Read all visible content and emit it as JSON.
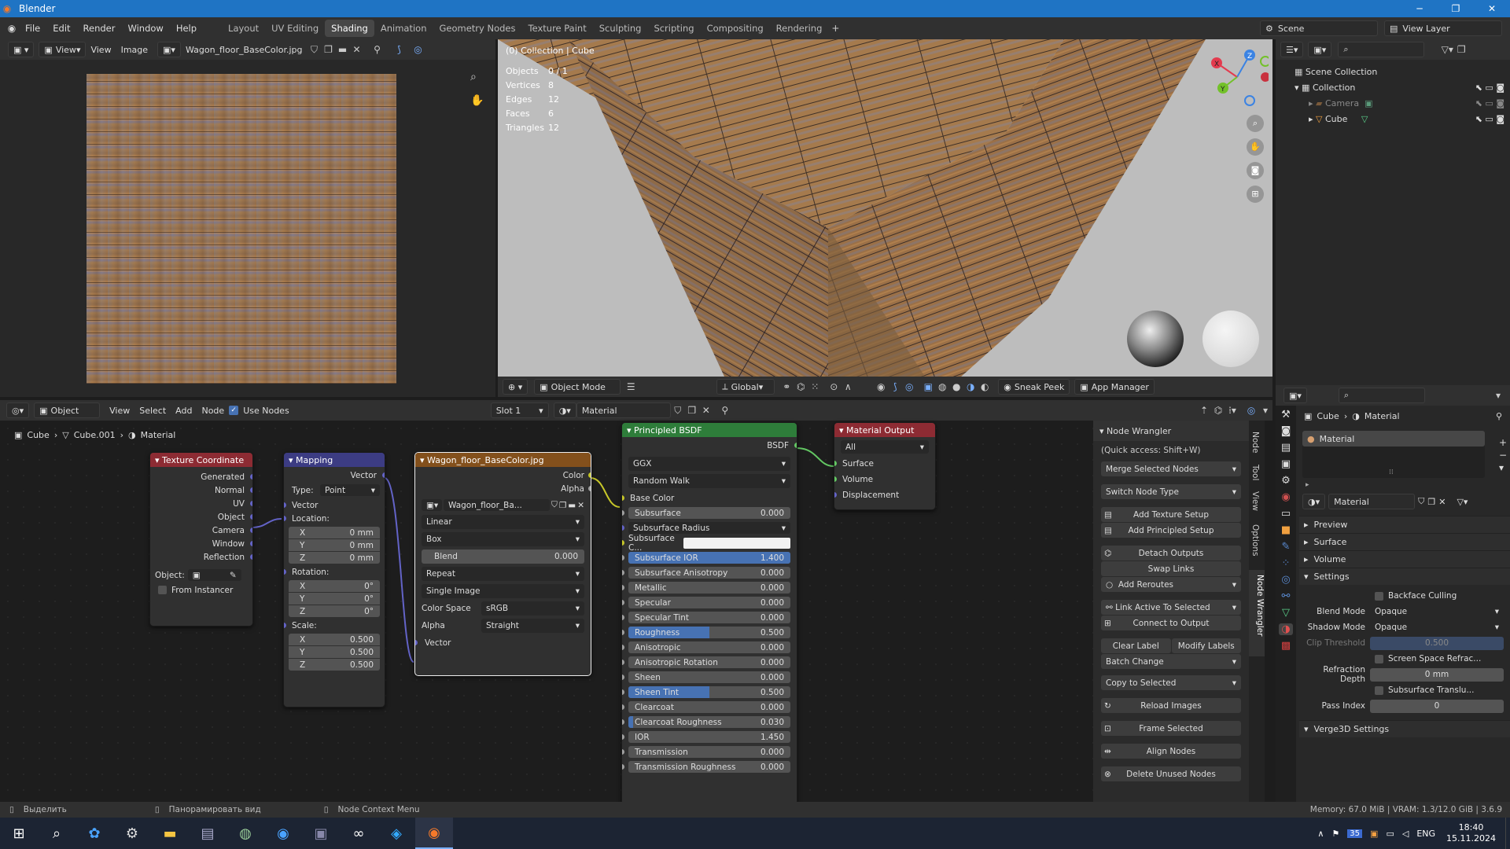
{
  "window": {
    "title": "Blender"
  },
  "menu": [
    "File",
    "Edit",
    "Render",
    "Window",
    "Help"
  ],
  "workspaces": [
    "Layout",
    "UV Editing",
    "Shading",
    "Animation",
    "Geometry Nodes",
    "Texture Paint",
    "Sculpting",
    "Scripting",
    "Compositing",
    "Rendering"
  ],
  "active_workspace": "Shading",
  "scene": "Scene",
  "view_layer": "View Layer",
  "image_editor": {
    "menus": [
      "View",
      "View",
      "Image"
    ],
    "image_name": "Wagon_floor_BaseColor.jpg"
  },
  "viewport": {
    "breadcrumb": "(0) Collection | Cube",
    "stats": [
      {
        "k": "Objects",
        "v": "0 / 1"
      },
      {
        "k": "Vertices",
        "v": "8"
      },
      {
        "k": "Edges",
        "v": "12"
      },
      {
        "k": "Faces",
        "v": "6"
      },
      {
        "k": "Triangles",
        "v": "12"
      }
    ],
    "mode": "Object Mode",
    "orientation": "Global",
    "sneak_peek": "Sneak Peek",
    "app_manager": "App Manager"
  },
  "outliner": {
    "items": [
      {
        "label": "Scene Collection"
      },
      {
        "label": "Collection"
      },
      {
        "label": "Camera"
      },
      {
        "label": "Cube"
      }
    ]
  },
  "node_editor": {
    "header": {
      "mode": "Object",
      "menus": [
        "View",
        "Select",
        "Add",
        "Node"
      ],
      "use_nodes": "Use Nodes",
      "slot": "Slot 1",
      "material": "Material"
    },
    "breadcrumb": [
      "Cube",
      "Cube.001",
      "Material"
    ]
  },
  "nodes": {
    "texcoord": {
      "title": "Texture Coordinate",
      "outputs": [
        "Generated",
        "Normal",
        "UV",
        "Object",
        "Camera",
        "Window",
        "Reflection"
      ],
      "object_label": "Object:",
      "from_instancer": "From Instancer"
    },
    "mapping": {
      "title": "Mapping",
      "output": "Vector",
      "type_label": "Type:",
      "type": "Point",
      "vector": "Vector",
      "location": "Location:",
      "rotation": "Rotation:",
      "scale": "Scale:",
      "loc": [
        {
          "a": "X",
          "v": "0 mm"
        },
        {
          "a": "Y",
          "v": "0 mm"
        },
        {
          "a": "Z",
          "v": "0 mm"
        }
      ],
      "rot": [
        {
          "a": "X",
          "v": "0°"
        },
        {
          "a": "Y",
          "v": "0°"
        },
        {
          "a": "Z",
          "v": "0°"
        }
      ],
      "scl": [
        {
          "a": "X",
          "v": "0.500"
        },
        {
          "a": "Y",
          "v": "0.500"
        },
        {
          "a": "Z",
          "v": "0.500"
        }
      ]
    },
    "image": {
      "title": "Wagon_floor_BaseColor.jpg",
      "outputs": [
        "Color",
        "Alpha"
      ],
      "img": "Wagon_floor_Ba...",
      "interp": "Linear",
      "proj": "Box",
      "blend_label": "Blend",
      "blend": "0.000",
      "ext": "Repeat",
      "source": "Single Image",
      "cs_label": "Color Space",
      "cs": "sRGB",
      "alpha_label": "Alpha",
      "alpha": "Straight",
      "vector": "Vector"
    },
    "bsdf": {
      "title": "Principled BSDF",
      "output": "BSDF",
      "dist": "GGX",
      "sss": "Random Walk",
      "base_color": "Base Color",
      "rows": [
        {
          "k": "Subsurface",
          "v": "0.000",
          "f": 0
        },
        {
          "k": "Subsurface Radius",
          "v": "",
          "f": -1
        },
        {
          "k": "Subsurface C...",
          "v": "",
          "f": -2
        },
        {
          "k": "Subsurface IOR",
          "v": "1.400",
          "f": 1
        },
        {
          "k": "Subsurface Anisotropy",
          "v": "0.000",
          "f": 0
        },
        {
          "k": "Metallic",
          "v": "0.000",
          "f": 0
        },
        {
          "k": "Specular",
          "v": "0.000",
          "f": 0
        },
        {
          "k": "Specular Tint",
          "v": "0.000",
          "f": 0
        },
        {
          "k": "Roughness",
          "v": "0.500",
          "f": 0.5
        },
        {
          "k": "Anisotropic",
          "v": "0.000",
          "f": 0
        },
        {
          "k": "Anisotropic Rotation",
          "v": "0.000",
          "f": 0
        },
        {
          "k": "Sheen",
          "v": "0.000",
          "f": 0
        },
        {
          "k": "Sheen Tint",
          "v": "0.500",
          "f": 0.5
        },
        {
          "k": "Clearcoat",
          "v": "0.000",
          "f": 0
        },
        {
          "k": "Clearcoat Roughness",
          "v": "0.030",
          "f": 0.03
        },
        {
          "k": "IOR",
          "v": "1.450",
          "f": 0
        },
        {
          "k": "Transmission",
          "v": "0.000",
          "f": 0
        },
        {
          "k": "Transmission Roughness",
          "v": "0.000",
          "f": 0
        }
      ]
    },
    "output": {
      "title": "Material Output",
      "target": "All",
      "inputs": [
        "Surface",
        "Volume",
        "Displacement"
      ]
    }
  },
  "node_wrangler": {
    "title": "Node Wrangler",
    "hint": "(Quick access: Shift+W)",
    "buttons": {
      "merge": "Merge Selected Nodes",
      "switch": "Switch Node Type",
      "add_tex": "Add Texture Setup",
      "add_princ": "Add Principled Setup",
      "detach": "Detach Outputs",
      "swap": "Swap Links",
      "reroutes": "Add Reroutes",
      "link_active": "Link Active To Selected",
      "connect": "Connect to Output",
      "clear": "Clear Label",
      "modify": "Modify Labels",
      "batch": "Batch Change",
      "copy": "Copy to Selected",
      "reload": "Reload Images",
      "frame": "Frame Selected",
      "align": "Align Nodes",
      "delete": "Delete Unused Nodes"
    },
    "tabs": [
      "Node",
      "Tool",
      "View",
      "Options",
      "Node Wrangler"
    ]
  },
  "properties": {
    "breadcrumb": [
      "Cube",
      "Material"
    ],
    "slot": "Material",
    "material": "Material",
    "panels": [
      "Preview",
      "Surface",
      "Volume",
      "Settings"
    ],
    "backface": "Backface Culling",
    "blend_label": "Blend Mode",
    "blend": "Opaque",
    "shadow_label": "Shadow Mode",
    "shadow": "Opaque",
    "clip_label": "Clip Threshold",
    "clip": "0.500",
    "ssr": "Screen Space Refrac...",
    "refr_label": "Refraction Depth",
    "refr": "0 mm",
    "sst": "Subsurface Translu...",
    "pass_label": "Pass Index",
    "pass": "0",
    "verge": "Verge3D Settings"
  },
  "status": {
    "select": "Выделить",
    "pan": "Панорамировать вид",
    "ctx": "Node Context Menu",
    "memory": "Memory: 67.0 MiB | VRAM: 1.3/12.0 GiB | 3.6.9"
  },
  "taskbar": {
    "lang": "ENG",
    "time": "18:40",
    "date": "15.11.2024",
    "badge": "35"
  }
}
